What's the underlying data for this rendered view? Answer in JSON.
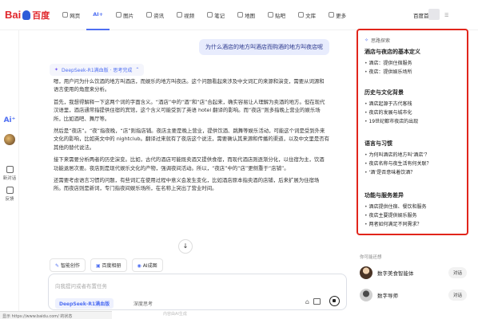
{
  "brand": {
    "left": "Bai",
    "right": "百度"
  },
  "nav": {
    "tabs": [
      {
        "label": "网页",
        "active": false
      },
      {
        "label": "AI+",
        "active": true
      },
      {
        "label": "图片",
        "active": false
      },
      {
        "label": "资讯",
        "active": false
      },
      {
        "label": "视频",
        "active": false
      },
      {
        "label": "笔记",
        "active": false
      },
      {
        "label": "地图",
        "active": false
      },
      {
        "label": "贴吧",
        "active": false
      },
      {
        "label": "文库",
        "active": false
      },
      {
        "label": "更多",
        "active": false
      }
    ],
    "home_label": "百度首页",
    "accent": "#4e6ef2"
  },
  "sidebar": {
    "ai_label": "Ai⁺",
    "new_chat": "新对话",
    "feedback": "反馈"
  },
  "chat": {
    "question": "为什么酒店的地方叫酒店而购酒的地方叫夜店呢",
    "model_bar": "DeepSeek-R1满血版 · 思考完成",
    "answer_paragraphs": [
      "嗯，用户问为什么饮酒的地方叫酒店，而娱乐的地方叫夜店。这个问题看起来涉及中文词汇的来源和演变，需要从词源和语言使用的角度来分析。",
      "首先，我想得解释一下这两个词的字面含义。“酒店”中的“酒”和“店”合起来，确实容易让人理解为卖酒的地方。但在现代汉语里，酒店通常指提供住宿的宾馆，这个含义可能受到了英语 hotel 翻译的影响。而“夜店”则多指晚上营业的娱乐场所，比如酒吧、舞厅等。",
      "然后是“夜店”。“夜”指夜晚，“店”则指店铺。夜店主要是晚上营业，提供饮酒、跳舞等娱乐活动，可能这个词是受到外来文化的影响，比如英文中的 nightclub。翻译过来就有了夜店这个说法，需要确认其来源和传播的渠道，以及中文里是否有其他的替代说法。",
      "接下来需要分析两者的历史演变。比如，古代的酒店可能既卖酒又提供食宿，而现代酒店则逐渐分化，以住宿为主，饮酒功能退居次要。夜店则是现代娱乐文化的产物，强调夜间活动。所以，“夜店”中的“店”更侧重于“店铺”。",
      "还需要考虑语言习惯的问题，有些词汇在使用过程中意义会发生变化，比如酒店原本指卖酒的店铺，后来扩展为住宿场所。而夜店则是新词，专门指夜间娱乐场所，在名称上突出了营业时间。"
    ],
    "actions": [
      "智能创作",
      "百度相册",
      "AI成图"
    ],
    "input_placeholder": "向我提问或者布置任务",
    "input_model": "DeepSeek-R1满血版",
    "input_deep": "深度思考",
    "footer": "内容由AI生成"
  },
  "panel": {
    "title": "思路探索",
    "groups": [
      {
        "title": "酒店与夜店的基本定义",
        "items": [
          "酒店：提供住宿服务",
          "夜店：提供娱乐场所"
        ]
      },
      {
        "title": "历史与文化背景",
        "items": [
          "酒店起源于古代客栈",
          "夜店的发展与城市化",
          "19世纪都市夜店的出现"
        ]
      },
      {
        "title": "语言与习惯",
        "items": [
          "为何叫酒店的地方叫‘酒店’？",
          "夜店名称与夜生活有何关联？",
          "‘酒’是否意味着饮酒？"
        ]
      },
      {
        "title": "功能与服务差异",
        "items": [
          "酒店提供住宿、餐饮和服务",
          "夜店主要提供娱乐服务",
          "两者如何满足不同需求？"
        ]
      }
    ],
    "border_color": "#e1251b"
  },
  "related": {
    "title": "你可能还想",
    "items": [
      {
        "name": "数字美食智能体",
        "button": "对话"
      },
      {
        "name": "数字导师",
        "button": "对话"
      }
    ]
  },
  "statusbar": {
    "text": "显示 https://www.baidu.com/ 的状态"
  }
}
